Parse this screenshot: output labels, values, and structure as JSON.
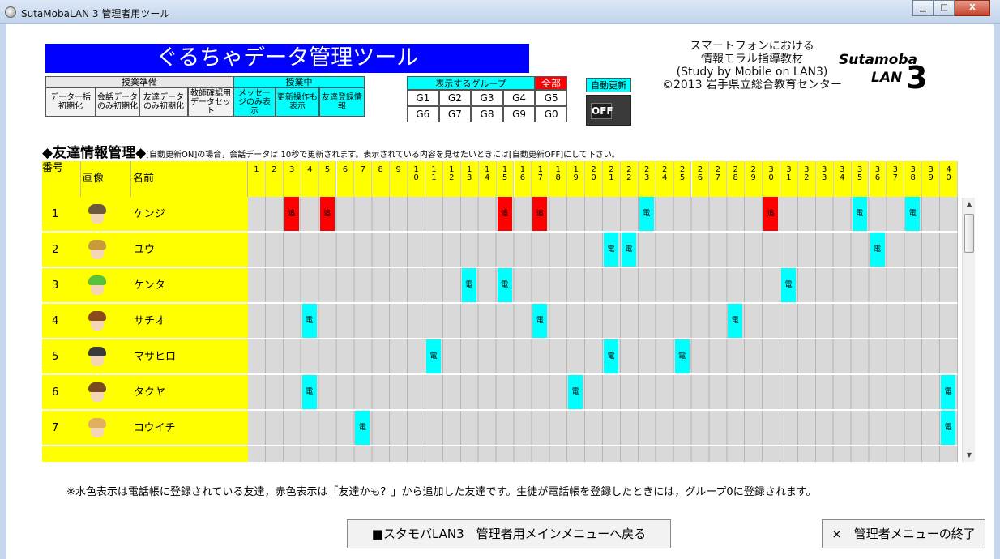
{
  "window": {
    "title": "SutaMobaLAN 3 管理者用ツール",
    "btn_min": "▁",
    "btn_max": "□",
    "btn_close": "X"
  },
  "header": {
    "title": "ぐるちゃデータ管理ツール",
    "class_prep": {
      "label": "授業準備",
      "buttons": [
        "データ一括初期化",
        "会話データのみ初期化",
        "友達データのみ初期化",
        "教師確認用データセット"
      ]
    },
    "in_class": {
      "label": "授業中",
      "buttons": [
        "メッセージのみ表示",
        "更新操作も表示",
        "友達登録情報"
      ]
    },
    "groups": {
      "label": "表示するグループ",
      "all": "全部",
      "row1": [
        "G1",
        "G2",
        "G3",
        "G4",
        "G5"
      ],
      "row2": [
        "G6",
        "G7",
        "G8",
        "G9",
        "G0"
      ]
    },
    "auto_update": {
      "label": "自動更新",
      "state": "OFF"
    },
    "credits": {
      "line1": "スマートフォンにおける",
      "line2": "情報モラル指導教材",
      "line3": "(Study by Mobile on LAN3)",
      "line4": "©2013 岩手県立総合教育センター"
    },
    "brand": {
      "name": "Sutamoba",
      "lan": "LAN",
      "version": "3"
    }
  },
  "section": {
    "heading": "◆友達情報管理◆",
    "note": "[自動更新ON]の場合，会話データは 10秒で更新されます。表示されている内容を見せたいときには[自動更新OFF]にして下さい。"
  },
  "table": {
    "columns": {
      "num": "番号",
      "image": "画像",
      "name": "名前"
    },
    "number_headers": [
      "1",
      "2",
      "3",
      "4",
      "5",
      "6",
      "7",
      "8",
      "9",
      "1\n0",
      "1\n1",
      "1\n2",
      "1\n3",
      "1\n4",
      "1\n5",
      "1\n6",
      "1\n7",
      "1\n8",
      "1\n9",
      "2\n0",
      "2\n1",
      "2\n2",
      "2\n3",
      "2\n4",
      "2\n5",
      "2\n6",
      "2\n7",
      "2\n8",
      "2\n9",
      "3\n0",
      "3\n1",
      "3\n2",
      "3\n3",
      "3\n4",
      "3\n5",
      "3\n6",
      "3\n7",
      "3\n8",
      "3\n9",
      "4\n0"
    ],
    "rows": [
      {
        "num": "1",
        "name": "ケンジ",
        "hair_color": "#6b5a3c",
        "marks": [
          {
            "col": 3,
            "type": "red",
            "text": "追"
          },
          {
            "col": 5,
            "type": "red",
            "text": "追"
          },
          {
            "col": 15,
            "type": "red",
            "text": "追"
          },
          {
            "col": 17,
            "type": "red",
            "text": "追"
          },
          {
            "col": 23,
            "type": "blue",
            "text": "電"
          },
          {
            "col": 30,
            "type": "red",
            "text": "追"
          },
          {
            "col": 35,
            "type": "blue",
            "text": "電"
          },
          {
            "col": 38,
            "type": "blue",
            "text": "電"
          }
        ]
      },
      {
        "num": "2",
        "name": "ユウ",
        "hair_color": "#c99a3b",
        "marks": [
          {
            "col": 21,
            "type": "blue",
            "text": "電"
          },
          {
            "col": 22,
            "type": "blue",
            "text": "電"
          },
          {
            "col": 36,
            "type": "blue",
            "text": "電"
          }
        ]
      },
      {
        "num": "3",
        "name": "ケンタ",
        "hair_color": "#58c23a",
        "marks": [
          {
            "col": 13,
            "type": "blue",
            "text": "電"
          },
          {
            "col": 15,
            "type": "blue",
            "text": "電"
          },
          {
            "col": 31,
            "type": "blue",
            "text": "電"
          }
        ]
      },
      {
        "num": "4",
        "name": "サチオ",
        "hair_color": "#8a4a1c",
        "marks": [
          {
            "col": 4,
            "type": "blue",
            "text": "電"
          },
          {
            "col": 17,
            "type": "blue",
            "text": "電"
          },
          {
            "col": 28,
            "type": "blue",
            "text": "電"
          }
        ]
      },
      {
        "num": "5",
        "name": "マサヒロ",
        "hair_color": "#3a3a3a",
        "marks": [
          {
            "col": 11,
            "type": "blue",
            "text": "電"
          },
          {
            "col": 21,
            "type": "blue",
            "text": "電"
          },
          {
            "col": 25,
            "type": "blue",
            "text": "電"
          }
        ]
      },
      {
        "num": "6",
        "name": "タクヤ",
        "hair_color": "#7a4a22",
        "marks": [
          {
            "col": 4,
            "type": "blue",
            "text": "電"
          },
          {
            "col": 19,
            "type": "blue",
            "text": "電"
          },
          {
            "col": 40,
            "type": "blue",
            "text": "電"
          }
        ]
      },
      {
        "num": "7",
        "name": "コウイチ",
        "hair_color": "#e0b060",
        "marks": [
          {
            "col": 7,
            "type": "blue",
            "text": "電"
          },
          {
            "col": 40,
            "type": "blue",
            "text": "電"
          }
        ]
      }
    ]
  },
  "footer": {
    "note": "※水色表示は電話帳に登録されている友達，赤色表示は「友達かも？」から追加した友達です。生徒が電話帳を登録したときには，グループ0に登録されます。",
    "main_menu_button": "■スタモバLAN3　管理者用メインメニューへ戻る",
    "quit_button": "×　管理者メニューの終了"
  },
  "colors": {
    "title_bg": "#0000ff",
    "cyan": "#00ffff",
    "yellow": "#ffff00",
    "red": "#ff0000",
    "cell_gray": "#d9d9d9"
  }
}
